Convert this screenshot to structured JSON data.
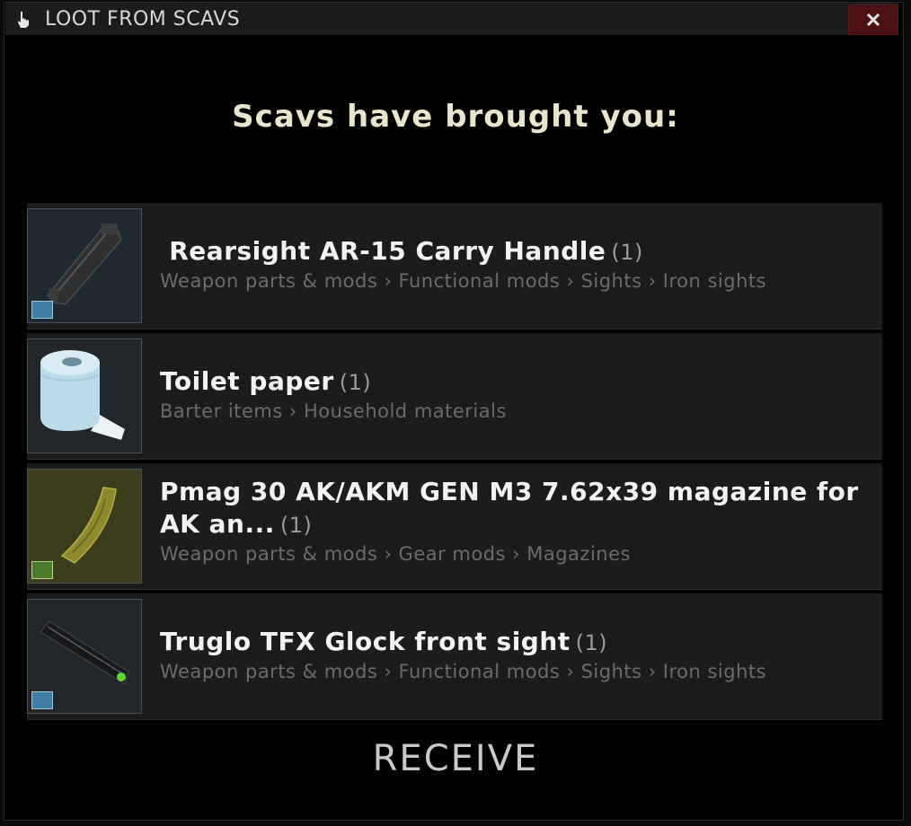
{
  "window": {
    "title": "LOOT FROM SCAVS"
  },
  "heading": "Scavs have brought you:",
  "items": [
    {
      "name": "Rearsight AR-15 Carry Handle",
      "count": "(1)",
      "path": "Weapon parts & mods › Functional mods › Sights › Iron sights",
      "icon": "carry-handle-icon"
    },
    {
      "name": "Toilet paper",
      "count": "(1)",
      "path": "Barter items › Household materials",
      "icon": "toilet-paper-icon"
    },
    {
      "name": "Pmag 30 AK/AKM GEN M3 7.62x39 magazine for AK an...",
      "count": "(1)",
      "path": "Weapon parts & mods › Gear mods › Magazines",
      "icon": "magazine-icon"
    },
    {
      "name": "Truglo TFX Glock front sight",
      "count": "(1)",
      "path": "Weapon parts & mods › Functional mods › Sights › Iron sights",
      "icon": "front-sight-icon"
    }
  ],
  "receive_label": "RECEIVE",
  "colors": {
    "heading": "#e9e4cc",
    "close_bg": "#4a1212",
    "row_bg": "#1c1c1c"
  }
}
